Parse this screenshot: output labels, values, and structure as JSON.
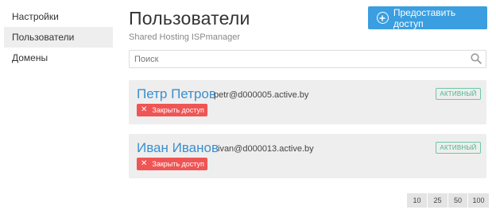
{
  "sidebar": {
    "items": [
      {
        "label": "Настройки",
        "active": false
      },
      {
        "label": "Пользователи",
        "active": true
      },
      {
        "label": "Домены",
        "active": false
      }
    ]
  },
  "header": {
    "title": "Пользователи",
    "subtitle": "Shared Hosting ISPmanager",
    "grant_button_label": "Предоставить доступ",
    "grant_button_icon": "plus-circle-icon"
  },
  "search": {
    "placeholder": "Поиск",
    "value": "",
    "icon": "search-icon"
  },
  "users": [
    {
      "name": "Петр Петров",
      "email": "petr@d000005.active.by",
      "status": "АКТИВНЫЙ",
      "revoke_label": "Закрыть доступ"
    },
    {
      "name": "Иван Иванов",
      "email": "ivan@d000013.active.by",
      "status": "АКТИВНЫЙ",
      "revoke_label": "Закрыть доступ"
    }
  ],
  "pagination": {
    "page_sizes": [
      "10",
      "25",
      "50",
      "100"
    ]
  },
  "colors": {
    "accent": "#3a9ee0",
    "link": "#3a8fd1",
    "danger": "#f05555",
    "status_active": "#4bb58c",
    "card_bg": "#eeeeee"
  }
}
